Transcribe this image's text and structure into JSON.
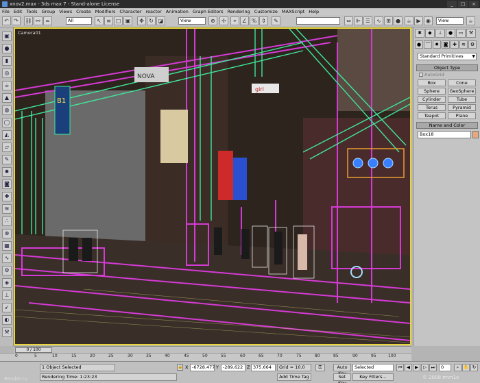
{
  "window": {
    "title": "xnov2.max - 3ds max 7 - Stand-alone License"
  },
  "menu": [
    "File",
    "Edit",
    "Tools",
    "Group",
    "Views",
    "Create",
    "Modifiers",
    "Character",
    "reactor",
    "Animation",
    "Graph Editors",
    "Rendering",
    "Customize",
    "MAXScript",
    "Help"
  ],
  "toolbar": {
    "selection_filter": "All",
    "ref_coord": "View",
    "named_selection": "",
    "right_view": "View"
  },
  "viewport": {
    "label": "Camera01",
    "border_color": "#e8d63a"
  },
  "command_panel": {
    "category": "Standard Primitives",
    "object_type_title": "Object Type",
    "autogrid_label": "AutoGrid",
    "buttons": [
      "Box",
      "Cone",
      "Sphere",
      "GeoSphere",
      "Cylinder",
      "Tube",
      "Torus",
      "Pyramid",
      "Teapot",
      "Plane"
    ],
    "name_color_title": "Name and Color",
    "object_name": "Box18",
    "swatch_color": "#e8a87c"
  },
  "timeline": {
    "slider_label": "0 / 100",
    "ticks": [
      "0",
      "5",
      "10",
      "15",
      "20",
      "25",
      "30",
      "35",
      "40",
      "45",
      "50",
      "55",
      "60",
      "65",
      "70",
      "75",
      "80",
      "85",
      "90",
      "95",
      "100"
    ]
  },
  "status": {
    "selected": "1 Object Selected",
    "render_time": "Rendering Time: 1:23:23",
    "x_label": "X",
    "x_value": "-6728.477",
    "y_label": "Y",
    "y_value": "-289.622",
    "z_label": "Z",
    "z_value": "375.664",
    "grid": "Grid = 10.0",
    "add_time_tag": "Add Time Tag",
    "auto_key": "Auto Key",
    "set_key": "Set Key",
    "key_mode": "Selected",
    "key_filters": "Key Filters...",
    "frame": "0"
  },
  "watermarks": {
    "left": "Render.ru",
    "right": "© 2008 mvn1x"
  }
}
